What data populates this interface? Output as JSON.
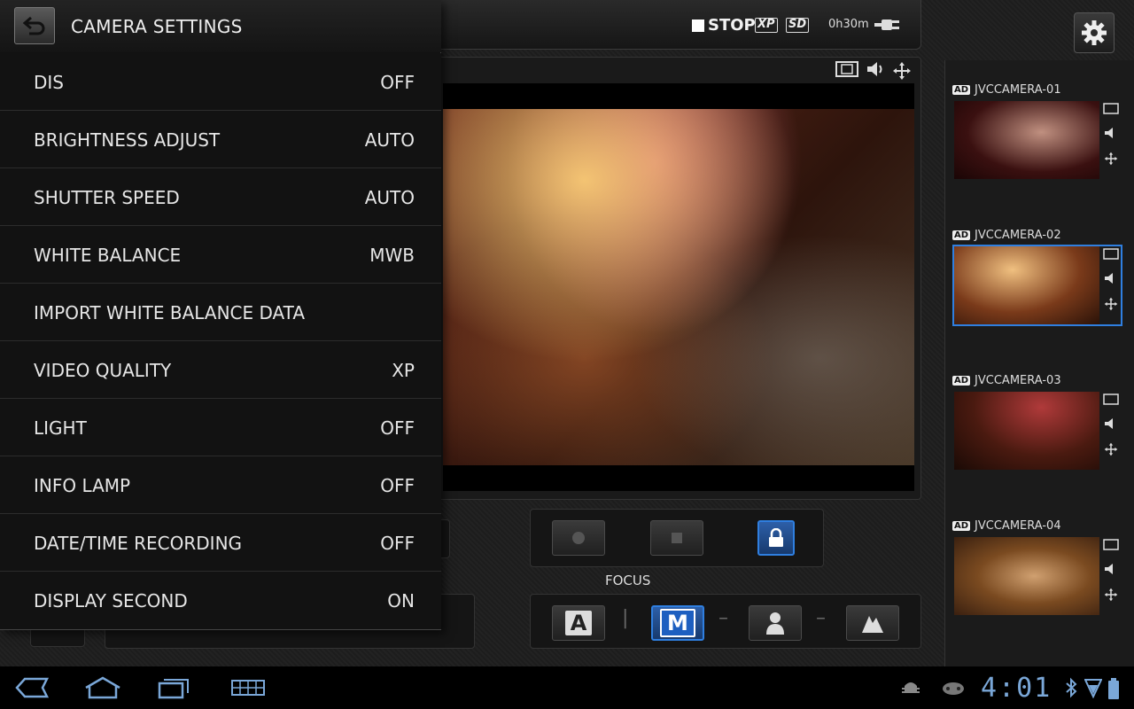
{
  "dialog": {
    "title": "CAMERA SETTINGS",
    "settings": [
      {
        "label": "DIS",
        "value": "OFF"
      },
      {
        "label": "BRIGHTNESS ADJUST",
        "value": "AUTO"
      },
      {
        "label": "SHUTTER SPEED",
        "value": "AUTO"
      },
      {
        "label": "WHITE BALANCE",
        "value": "MWB"
      },
      {
        "label": "IMPORT WHITE BALANCE DATA",
        "value": ""
      },
      {
        "label": "VIDEO QUALITY",
        "value": "XP"
      },
      {
        "label": "LIGHT",
        "value": "OFF"
      },
      {
        "label": "INFO LAMP",
        "value": "OFF"
      },
      {
        "label": "DATE/TIME RECORDING",
        "value": "OFF"
      },
      {
        "label": "DISPLAY SECOND",
        "value": "ON"
      }
    ]
  },
  "status": {
    "stop_label": "STOP",
    "quality_badge": "XP",
    "media_badge": "SD",
    "remaining_time": "0h30m"
  },
  "controls": {
    "focus_label": "FOCUS",
    "focus_auto": "A",
    "focus_manual": "M"
  },
  "cameras": [
    {
      "badge": "AD",
      "name": "JVCCAMERA-01",
      "selected": false
    },
    {
      "badge": "AD",
      "name": "JVCCAMERA-02",
      "selected": true
    },
    {
      "badge": "AD",
      "name": "JVCCAMERA-03",
      "selected": false
    },
    {
      "badge": "AD",
      "name": "JVCCAMERA-04",
      "selected": false
    }
  ],
  "system": {
    "clock": "4:01"
  },
  "colors": {
    "accent": "#2f7fe0",
    "clock": "#7aa7d8"
  },
  "icons": {
    "back": "back-arrow-icon",
    "settings": "gear-icon",
    "film": "film-icon",
    "audio": "speaker-icon",
    "move": "move-icon"
  }
}
